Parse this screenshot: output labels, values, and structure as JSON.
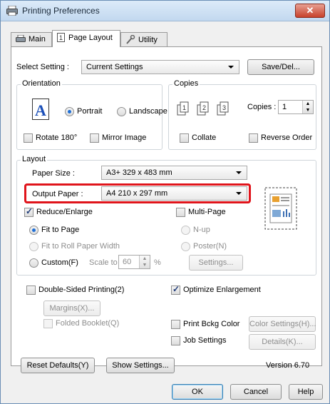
{
  "window": {
    "title": "Printing Preferences",
    "close_glyph": "✕"
  },
  "tabs": [
    {
      "label": "Main",
      "icon": "printer-icon"
    },
    {
      "label": "Page Layout",
      "icon": "page-icon",
      "active": true
    },
    {
      "label": "Utility",
      "icon": "wrench-icon"
    }
  ],
  "select_setting": {
    "label": "Select Setting :",
    "value": "Current Settings",
    "button": "Save/Del..."
  },
  "orientation": {
    "title": "Orientation",
    "portrait": "Portrait",
    "landscape": "Landscape",
    "selected": "Portrait",
    "rotate_180": "Rotate 180°",
    "mirror_image": "Mirror Image"
  },
  "copies": {
    "title": "Copies",
    "label": "Copies :",
    "value": "1",
    "collate": "Collate",
    "reverse_order": "Reverse Order"
  },
  "layout": {
    "title": "Layout",
    "paper_size_label": "Paper Size :",
    "paper_size_value": "A3+ 329 x 483 mm",
    "output_paper_label": "Output Paper :",
    "output_paper_value": "A4 210 x 297 mm",
    "reduce_enlarge": "Reduce/Enlarge",
    "fit_to_page": "Fit to Page",
    "fit_to_roll": "Fit to Roll Paper Width",
    "custom": "Custom(F)",
    "scale_to": "Scale to",
    "scale_value": "60",
    "percent": "%",
    "multi_page": "Multi-Page",
    "n_up": "N-up",
    "poster": "Poster(N)",
    "settings_button": "Settings..."
  },
  "double_sided": {
    "label": "Double-Sided Printing(2)",
    "margins_button": "Margins(X)...",
    "folded_booklet": "Folded Booklet(Q)"
  },
  "optimize_enlargement": "Optimize Enlargement",
  "print_bckg_color": "Print Bckg Color",
  "color_settings_button": "Color Settings(H)...",
  "job_settings": "Job Settings",
  "details_button": "Details(K)...",
  "reset_defaults_button": "Reset Defaults(Y)",
  "show_settings_button": "Show Settings...",
  "version": "Version 6.70",
  "dialog_buttons": {
    "ok": "OK",
    "cancel": "Cancel",
    "help": "Help"
  },
  "colors": {
    "highlight": "#e0141b",
    "radio_dot": "#1f6fd6"
  }
}
